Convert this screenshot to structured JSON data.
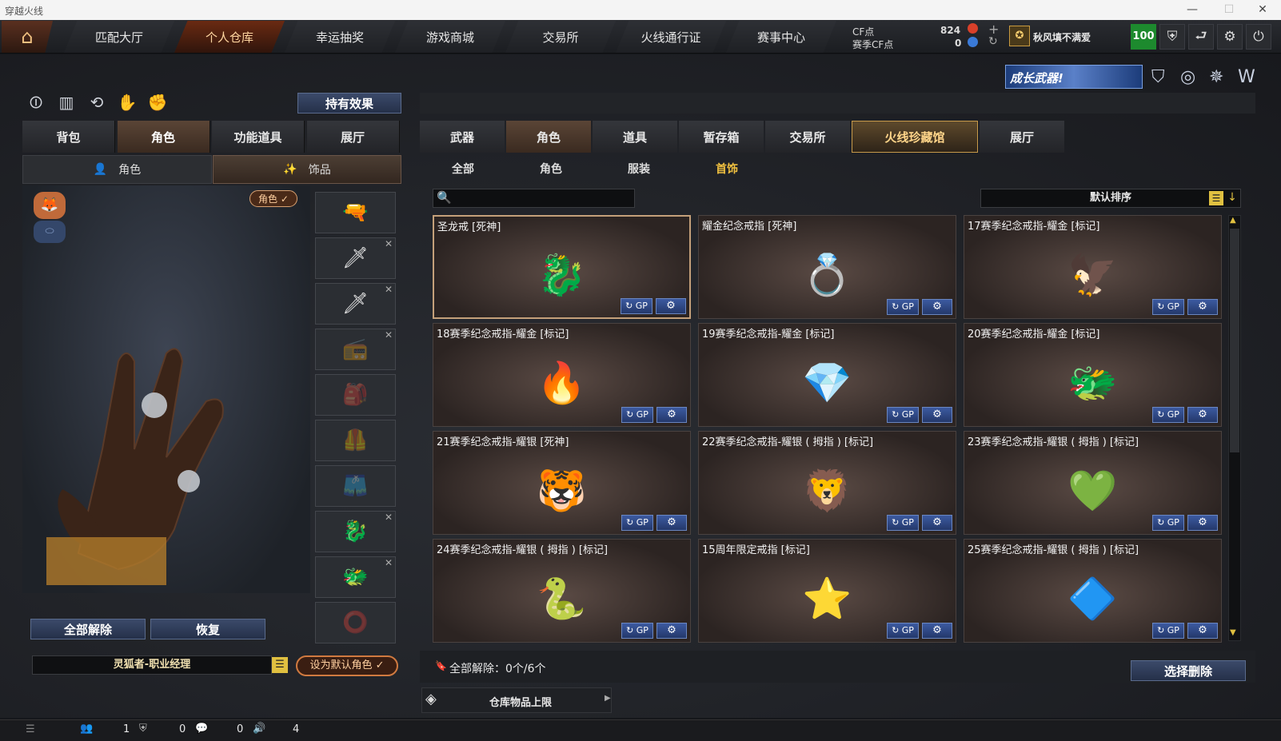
{
  "window": {
    "title": "穿越火线",
    "minimize": "—",
    "maximize": "☐",
    "close": "✕"
  },
  "nav": {
    "tabs": [
      "匹配大厅",
      "个人仓库",
      "幸运抽奖",
      "游戏商城",
      "交易所",
      "火线通行证",
      "赛事中心"
    ],
    "active": 1
  },
  "currency": {
    "cf_label": "CF点",
    "cf_value": "824",
    "season_label": "赛季CF点",
    "season_value": "0"
  },
  "user": {
    "name": "秋风填不满爱",
    "level": "100"
  },
  "banner": "成长武器!",
  "left": {
    "hold_effect": "持有效果",
    "tabs": [
      "背包",
      "角色",
      "功能道具",
      "展厅"
    ],
    "active_tab": 1,
    "sub_tabs": [
      "角色",
      "饰品"
    ],
    "role_badge": "角色 ✓",
    "unequip_all": "全部解除",
    "restore": "恢复",
    "character_name": "灵狐者-职业经理",
    "set_default": "设为默认角色 ✓"
  },
  "right": {
    "tabs": [
      "武器",
      "角色",
      "道具",
      "暂存箱",
      "交易所",
      "火线珍藏馆",
      "展厅"
    ],
    "active_tab": 1,
    "gold_tab": 5,
    "sub_tabs": [
      "全部",
      "角色",
      "服装",
      "首饰"
    ],
    "active_sub": 3,
    "sort_label": "默认排序",
    "items": [
      {
        "name": "圣龙戒 [死神]",
        "icon": "🐉"
      },
      {
        "name": "耀金纪念戒指 [死神]",
        "icon": "💍"
      },
      {
        "name": "17赛季纪念戒指-耀金 [标记]",
        "icon": "🦅"
      },
      {
        "name": "18赛季纪念戒指-耀金 [标记]",
        "icon": "🔥"
      },
      {
        "name": "19赛季纪念戒指-耀金 [标记]",
        "icon": "💎"
      },
      {
        "name": "20赛季纪念戒指-耀金 [标记]",
        "icon": "🐲"
      },
      {
        "name": "21赛季纪念戒指-耀银  [死神]",
        "icon": "🐯"
      },
      {
        "name": "22赛季纪念戒指-耀银 ( 拇指 ) [标记]",
        "icon": "🦁"
      },
      {
        "name": "23赛季纪念戒指-耀银 ( 拇指 ) [标记]",
        "icon": "💚"
      },
      {
        "name": "24赛季纪念戒指-耀银 ( 拇指 ) [标记]",
        "icon": "🐍"
      },
      {
        "name": "15周年限定戒指 [标记]",
        "icon": "⭐"
      },
      {
        "name": "25赛季纪念戒指-耀银 ( 拇指 ) [标记]",
        "icon": "🔷"
      }
    ],
    "gp_label": "↻ GP",
    "gear": "⚙",
    "unequip_summary": "全部解除：0个/6个",
    "select_delete": "选择删除",
    "storage_limit": "仓库物品上限"
  },
  "status": {
    "v1": "1",
    "v2": "0",
    "v3": "0",
    "v4": "4"
  }
}
